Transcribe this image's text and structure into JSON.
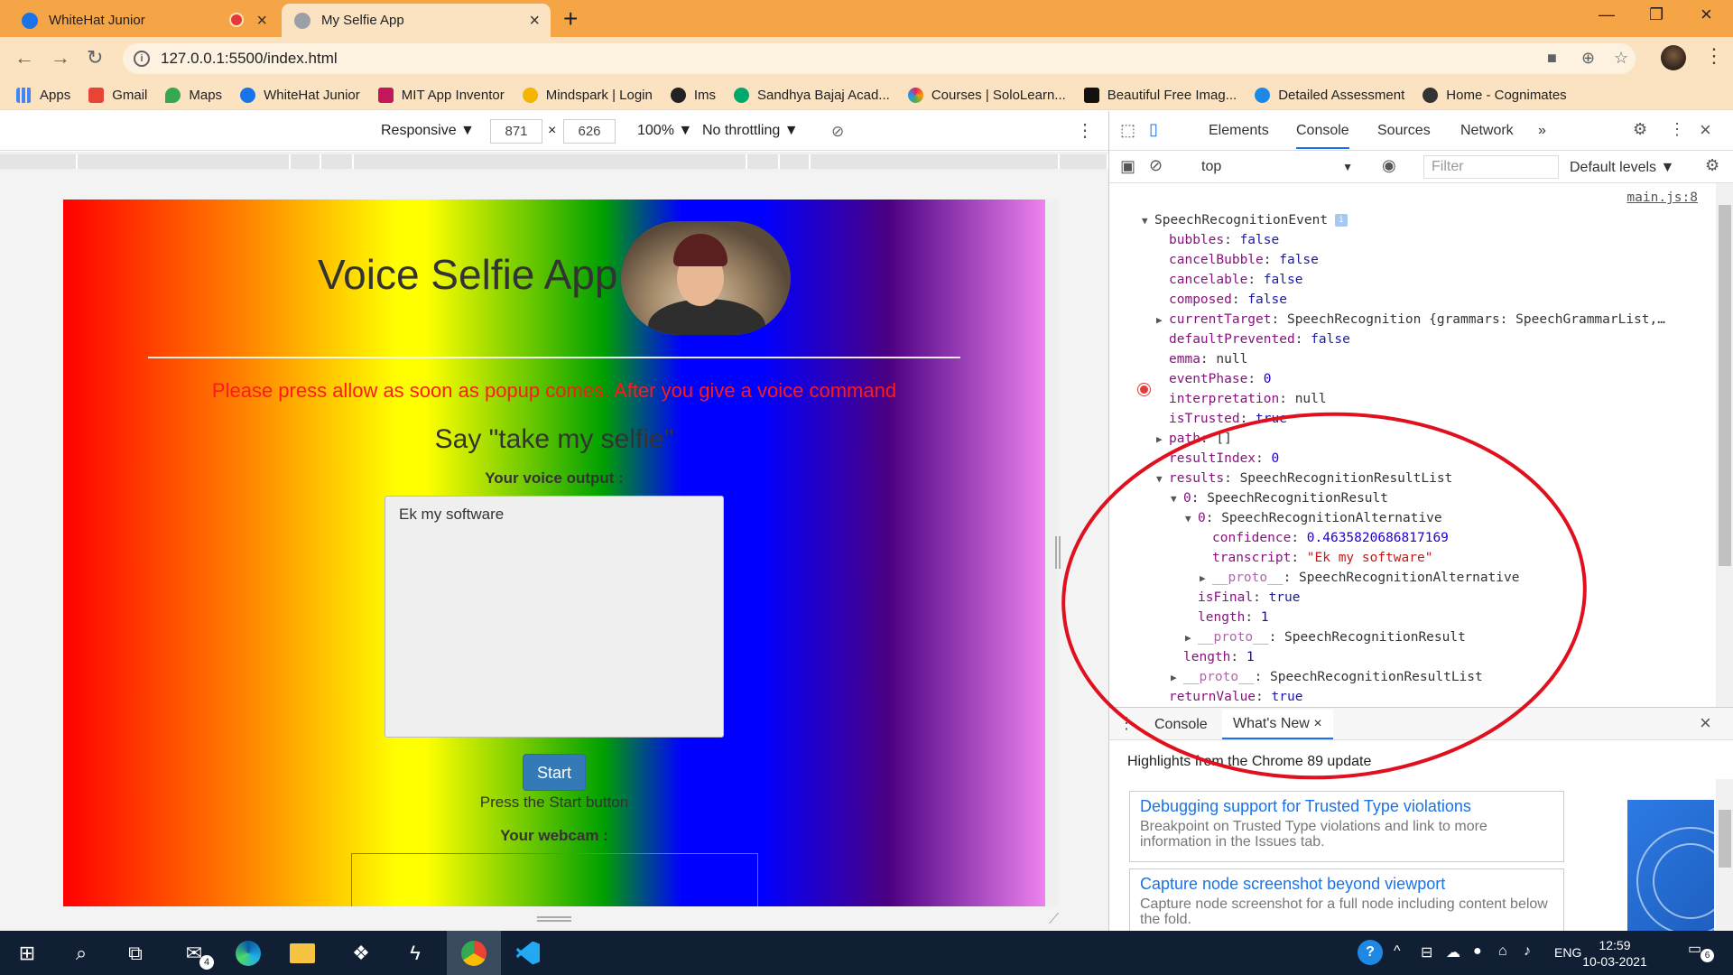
{
  "tabs": [
    {
      "title": "WhiteHat Junior",
      "recording": true,
      "active": false
    },
    {
      "title": "My Selfie App",
      "active": true
    }
  ],
  "address_bar": {
    "url": "127.0.0.1:5500/index.html"
  },
  "bookmarks": [
    {
      "label": "Apps",
      "icon": "apps-grid-icon",
      "color": "#4285f4"
    },
    {
      "label": "Gmail",
      "icon": "gmail-icon",
      "color": "#ea4335"
    },
    {
      "label": "Maps",
      "icon": "maps-pin-icon",
      "color": "#34a853"
    },
    {
      "label": "WhiteHat Junior",
      "icon": "whitehat-icon",
      "color": "#1a73e8"
    },
    {
      "label": "MIT App Inventor",
      "icon": "mit-icon",
      "color": "#c2185b"
    },
    {
      "label": "Mindspark | Login",
      "icon": "mindspark-icon",
      "color": "#f4b400"
    },
    {
      "label": "Ims",
      "icon": "ims-icon",
      "color": "#222222"
    },
    {
      "label": "Sandhya Bajaj Acad...",
      "icon": "academy-icon",
      "color": "#00a86b"
    },
    {
      "label": "Courses | SoloLearn...",
      "icon": "sololearn-icon",
      "color": "#e91e63"
    },
    {
      "label": "Beautiful Free Imag...",
      "icon": "unsplash-icon",
      "color": "#111111"
    },
    {
      "label": "Detailed Assessment",
      "icon": "assessment-icon",
      "color": "#1e88e5"
    },
    {
      "label": "Home - Cognimates",
      "icon": "cognimates-icon",
      "color": "#333333"
    }
  ],
  "device_toolbar": {
    "device": "Responsive ▼",
    "width": "871",
    "x": "×",
    "height": "626",
    "zoom": "100% ▼",
    "throttle": "No throttling ▼"
  },
  "app": {
    "title": "Voice Selfie App",
    "instruction": "Please press allow as soon as popup comes. After you give a voice command",
    "say": "Say \"take my selfie\"",
    "voice_label": "Your voice output :",
    "voice_text": "Ek my software",
    "start_button": "Start",
    "press_text": "Press the Start button",
    "webcam_label": "Your webcam :"
  },
  "devtools": {
    "tabs": [
      "Elements",
      "Console",
      "Sources",
      "Network",
      "»"
    ],
    "context": "top",
    "filter_placeholder": "Filter",
    "levels": "Default levels ▼",
    "source_link": "main.js:8",
    "drawer_tabs": [
      "Console",
      "What's New"
    ],
    "highlights": "Highlights from the Chrome 89 update",
    "cards": [
      {
        "title": "Debugging support for Trusted Type violations",
        "desc": "Breakpoint on Trusted Type violations and link to more information in the Issues tab."
      },
      {
        "title": "Capture node screenshot beyond viewport",
        "desc": "Capture node screenshot for a full node including content below the fold."
      }
    ]
  },
  "console_lines": [
    {
      "indent": 0,
      "tri": "▼",
      "key": "SpeechRecognitionEvent",
      "sep": "",
      "val": "",
      "vclass": "",
      "badge": true
    },
    {
      "indent": 1,
      "tri": "",
      "key": "bubbles",
      "sep": ": ",
      "val": "false",
      "vclass": "kw"
    },
    {
      "indent": 1,
      "tri": "",
      "key": "cancelBubble",
      "sep": ": ",
      "val": "false",
      "vclass": "kw"
    },
    {
      "indent": 1,
      "tri": "",
      "key": "cancelable",
      "sep": ": ",
      "val": "false",
      "vclass": "kw"
    },
    {
      "indent": 1,
      "tri": "",
      "key": "composed",
      "sep": ": ",
      "val": "false",
      "vclass": "kw"
    },
    {
      "indent": 1,
      "tri": "▶",
      "key": "currentTarget",
      "sep": ": ",
      "val": "SpeechRecognition {grammars: SpeechGrammarList,…",
      "vclass": ""
    },
    {
      "indent": 1,
      "tri": "",
      "key": "defaultPrevented",
      "sep": ": ",
      "val": "false",
      "vclass": "kw"
    },
    {
      "indent": 1,
      "tri": "",
      "key": "emma",
      "sep": ": ",
      "val": "null",
      "vclass": ""
    },
    {
      "indent": 1,
      "tri": "",
      "key": "eventPhase",
      "sep": ": ",
      "val": "0",
      "vclass": "num"
    },
    {
      "indent": 1,
      "tri": "",
      "key": "interpretation",
      "sep": ": ",
      "val": "null",
      "vclass": ""
    },
    {
      "indent": 1,
      "tri": "",
      "key": "isTrusted",
      "sep": ": ",
      "val": "true",
      "vclass": "kw"
    },
    {
      "indent": 1,
      "tri": "▶",
      "key": "path",
      "sep": ": ",
      "val": "[]",
      "vclass": ""
    },
    {
      "indent": 1,
      "tri": "",
      "key": "resultIndex",
      "sep": ": ",
      "val": "0",
      "vclass": "num"
    },
    {
      "indent": 1,
      "tri": "▼",
      "key": "results",
      "sep": ": ",
      "val": "SpeechRecognitionResultList",
      "vclass": ""
    },
    {
      "indent": 2,
      "tri": "▼",
      "key": "0",
      "sep": ": ",
      "val": "SpeechRecognitionResult",
      "vclass": ""
    },
    {
      "indent": 3,
      "tri": "▼",
      "key": "0",
      "sep": ": ",
      "val": "SpeechRecognitionAlternative",
      "vclass": ""
    },
    {
      "indent": 4,
      "tri": "",
      "key": "confidence",
      "sep": ": ",
      "val": "0.4635820686817169",
      "vclass": "num"
    },
    {
      "indent": 4,
      "tri": "",
      "key": "transcript",
      "sep": ": ",
      "val": "\"Ek my software\"",
      "vclass": "str"
    },
    {
      "indent": 4,
      "tri": "▶",
      "key": "__proto__",
      "sep": ": ",
      "val": "SpeechRecognitionAlternative",
      "vclass": "",
      "proto": true
    },
    {
      "indent": 3,
      "tri": "",
      "key": "isFinal",
      "sep": ": ",
      "val": "true",
      "vclass": "kw"
    },
    {
      "indent": 3,
      "tri": "",
      "key": "length",
      "sep": ": ",
      "val": "1",
      "vclass": "num"
    },
    {
      "indent": 3,
      "tri": "▶",
      "key": "__proto__",
      "sep": ": ",
      "val": "SpeechRecognitionResult",
      "vclass": "",
      "proto": true
    },
    {
      "indent": 2,
      "tri": "",
      "key": "length",
      "sep": ": ",
      "val": "1",
      "vclass": "num"
    },
    {
      "indent": 2,
      "tri": "▶",
      "key": "__proto__",
      "sep": ": ",
      "val": "SpeechRecognitionResultList",
      "vclass": "",
      "proto": true
    },
    {
      "indent": 1,
      "tri": "",
      "key": "returnValue",
      "sep": ": ",
      "val": "true",
      "vclass": "kw"
    }
  ],
  "taskbar": {
    "mail_badge": "4",
    "time": "12:59",
    "date": "10-03-2021",
    "lang": "ENG",
    "notif_count": "6"
  },
  "colors": {
    "tab_strip": "#f5a545",
    "toolbar": "#fbe3c2",
    "instruction_text": "#ff1a1a",
    "start_button": "#337ab7",
    "annotation": "#e0101e",
    "taskbar": "#101f33"
  }
}
